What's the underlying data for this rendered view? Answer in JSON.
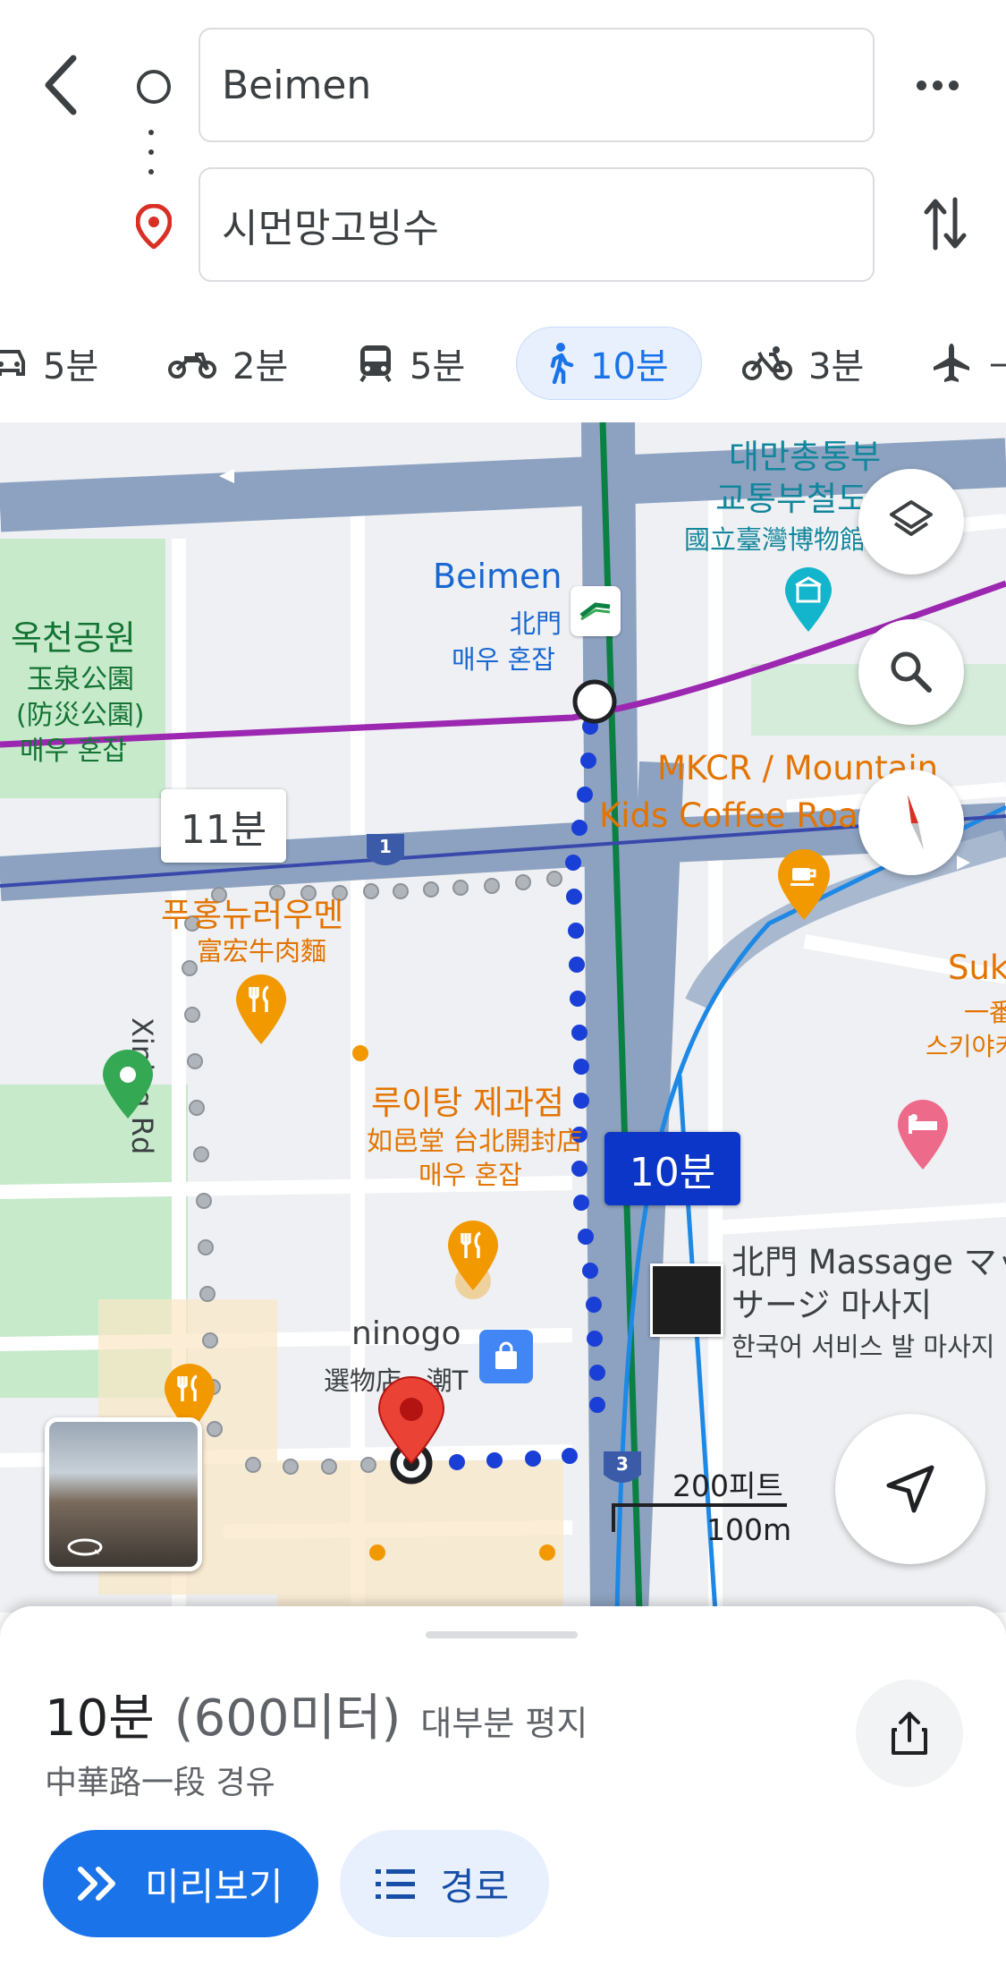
{
  "search": {
    "origin": "Beimen",
    "destination": "시먼망고빙수"
  },
  "modes": [
    {
      "icon": "car-icon",
      "label": "5분"
    },
    {
      "icon": "motorcycle-icon",
      "label": "2분"
    },
    {
      "icon": "transit-icon",
      "label": "5분"
    },
    {
      "icon": "walk-icon",
      "label": "10분",
      "active": true
    },
    {
      "icon": "bike-icon",
      "label": "3분"
    },
    {
      "icon": "flight-icon",
      "label": "—"
    }
  ],
  "map": {
    "labels": {
      "yuquan_park_kr": "옥천공원",
      "yuquan_park_zh1": "玉泉公園",
      "yuquan_park_zh2": "(防災公園)",
      "busy1": "매우 혼잡",
      "station_en": "Beimen",
      "station_zh": "北門",
      "busy2": "매우 혼잡",
      "museum_kr1": "대만총통부",
      "museum_kr2": "교통부철도",
      "museum_zh": "國立臺灣博物館",
      "mkcr1": "MKCR / Mountain",
      "mkcr2": "Kids Coffee Roa... I...",
      "beef_kr": "푸홍뉴러우멘",
      "beef_zh": "富宏牛肉麵",
      "xining": "Xining Rd",
      "bakery_kr": "루이탕 제과점",
      "bakery_zh": "如邑堂 台北開封店",
      "busy3": "매우 혼잡",
      "ninogo": "ninogo",
      "ninogo_zh": "選物店 · 潮T",
      "massage1": "北門 Massage マッ",
      "massage2": "サージ 마사지",
      "massage3": "한국어 서비스 발 마사지",
      "suk": "Suk",
      "suk_zh1": "一番",
      "suk_zh2": "스키야키",
      "scale_ft": "200피트",
      "scale_m": "100m",
      "alt_time": "11분",
      "main_time": "10분",
      "road1": "1",
      "road3": "3"
    },
    "colors": {
      "route": "#1a3fd6",
      "purple_line": "#9c27b0",
      "green_line": "#0b8043",
      "poi_orange": "#f29900",
      "park": "#c7eacb"
    }
  },
  "sheet": {
    "duration": "10분",
    "distance": "(600미터)",
    "terrain": "대부분 평지",
    "via": "中華路一段 경유",
    "preview_label": "미리보기",
    "steps_label": "경로"
  }
}
